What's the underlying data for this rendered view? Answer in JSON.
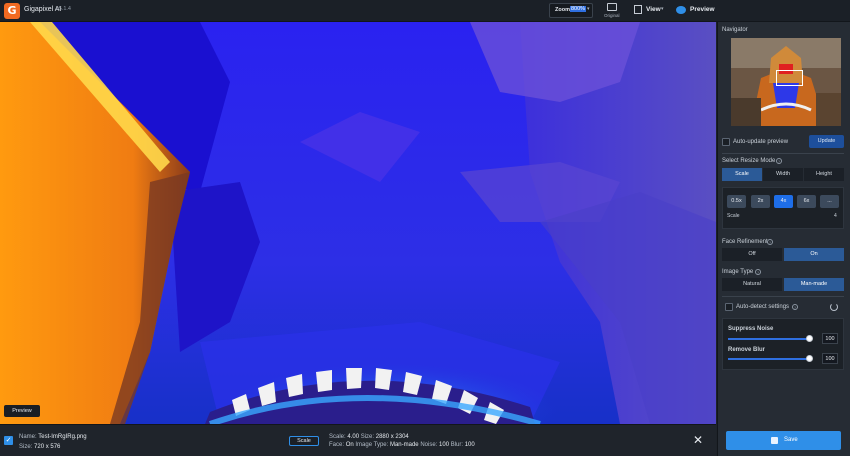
{
  "app": {
    "name": "Gigapixel AI",
    "version": "v5.1.4"
  },
  "topbar": {
    "zoom_label": "Zoom",
    "zoom_value": "800%",
    "original_label": "Original",
    "view_label": "View",
    "preview_label": "Preview"
  },
  "canvas": {
    "preview_tag": "Preview"
  },
  "panel": {
    "navigator_title": "Navigator",
    "auto_update_label": "Auto-update preview",
    "update_button": "Update",
    "resize_mode": {
      "title": "Select Resize Mode",
      "options": [
        "Scale",
        "Width",
        "Height"
      ],
      "selected": "Scale"
    },
    "scale": {
      "buttons": [
        "0.5x",
        "2x",
        "4x",
        "6x",
        "..."
      ],
      "selected": "4x",
      "label": "Scale",
      "value": "4"
    },
    "face_refinement": {
      "title": "Face Refinement",
      "options": [
        "Off",
        "On"
      ],
      "selected": "On"
    },
    "image_type": {
      "title": "Image Type",
      "options": [
        "Natural",
        "Man-made"
      ],
      "selected": "Man-made"
    },
    "auto_detect_label": "Auto-detect settings",
    "suppress_noise": {
      "label": "Suppress Noise",
      "value": "100",
      "level": 1.0
    },
    "remove_blur": {
      "label": "Remove Blur",
      "value": "100",
      "level": 1.0
    }
  },
  "bottom": {
    "name_label": "Name:",
    "name_value": "Test-ImRgIRg.png",
    "size_label": "Size:",
    "size_value": "720 x 576",
    "mode_chip": "Scale",
    "scale_label": "Scale:",
    "scale_value": "4.00",
    "out_size_label": "Size:",
    "out_size_value": "2880 x 2304",
    "face_label": "Face:",
    "face_value": "On",
    "image_type_label": "Image Type:",
    "image_type_value": "Man-made",
    "noise_label": "Noise:",
    "noise_value": "100",
    "blur_label": "Blur:",
    "blur_value": "100",
    "save_label": "Save"
  },
  "colors": {
    "accent": "#2f8fe8",
    "selected": "#2b5a97",
    "brand": "#f26a22"
  }
}
